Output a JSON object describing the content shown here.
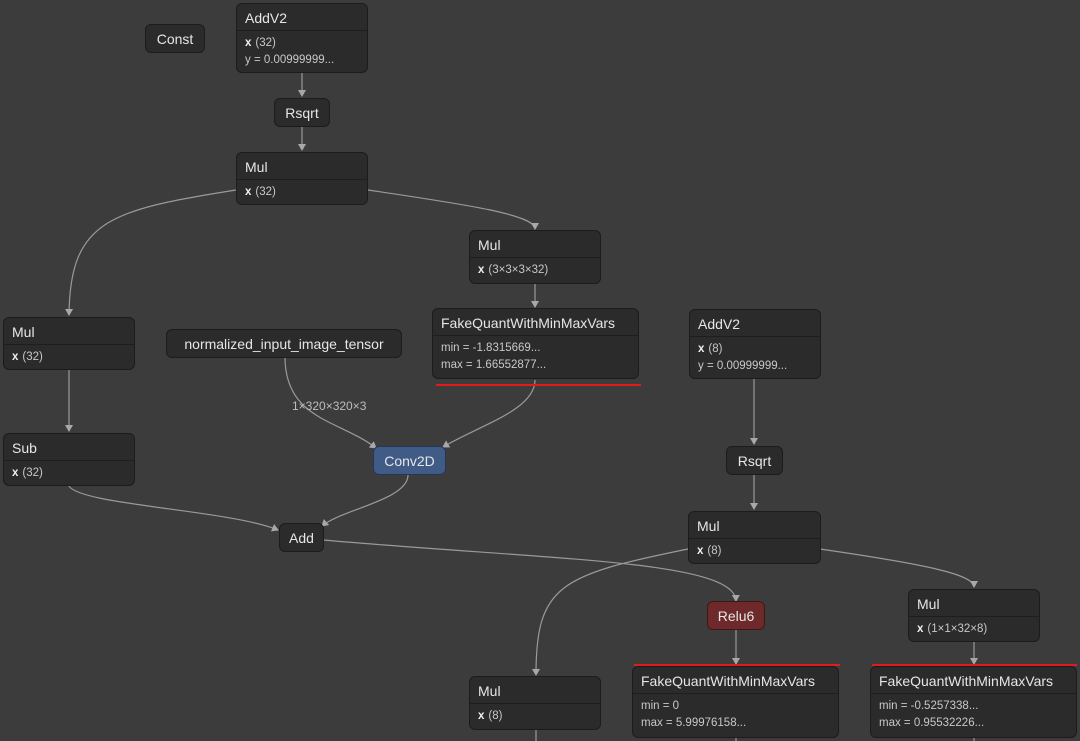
{
  "nodes": {
    "const": {
      "title": "Const"
    },
    "addv2_top": {
      "title": "AddV2",
      "x": "(32)",
      "y_attr": "y = 0.00999999..."
    },
    "rsqrt_top": {
      "title": "Rsqrt"
    },
    "mul_top": {
      "title": "Mul",
      "x": "(32)"
    },
    "mul_weights": {
      "title": "Mul",
      "x": "(3×3×3×32)"
    },
    "fq_weights": {
      "title": "FakeQuantWithMinMaxVars",
      "min": "min = -1.8315669...",
      "max": "max = 1.66552877..."
    },
    "mul_left": {
      "title": "Mul",
      "x": "(32)"
    },
    "input_tensor": {
      "title": "normalized_input_image_tensor"
    },
    "sub": {
      "title": "Sub",
      "x": "(32)"
    },
    "conv2d": {
      "title": "Conv2D"
    },
    "add": {
      "title": "Add"
    },
    "addv2_right": {
      "title": "AddV2",
      "x": "(8)",
      "y_attr": "y = 0.00999999..."
    },
    "rsqrt_right": {
      "title": "Rsqrt"
    },
    "mul_right": {
      "title": "Mul",
      "x": "(8)"
    },
    "relu6": {
      "title": "Relu6"
    },
    "mul_right2": {
      "title": "Mul",
      "x": "(1×1×32×8)"
    },
    "mul_bottom": {
      "title": "Mul",
      "x": "(8)"
    },
    "fq_relu": {
      "title": "FakeQuantWithMinMaxVars",
      "min": "min = 0",
      "max": "max = 5.99976158..."
    },
    "fq_right": {
      "title": "FakeQuantWithMinMaxVars",
      "min": "min = -0.5257338...",
      "max": "max = 0.95532226..."
    }
  },
  "x_attr_label": "x",
  "edge_labels": {
    "input_shape": "1×320×320×3"
  },
  "colors": {
    "background": "#3c3c3c",
    "node": "#2b2b2b",
    "conv": "#3f5b86",
    "relu": "#6e2a2a",
    "highlight": "#e21a1a",
    "edge": "#9a9a9a"
  }
}
